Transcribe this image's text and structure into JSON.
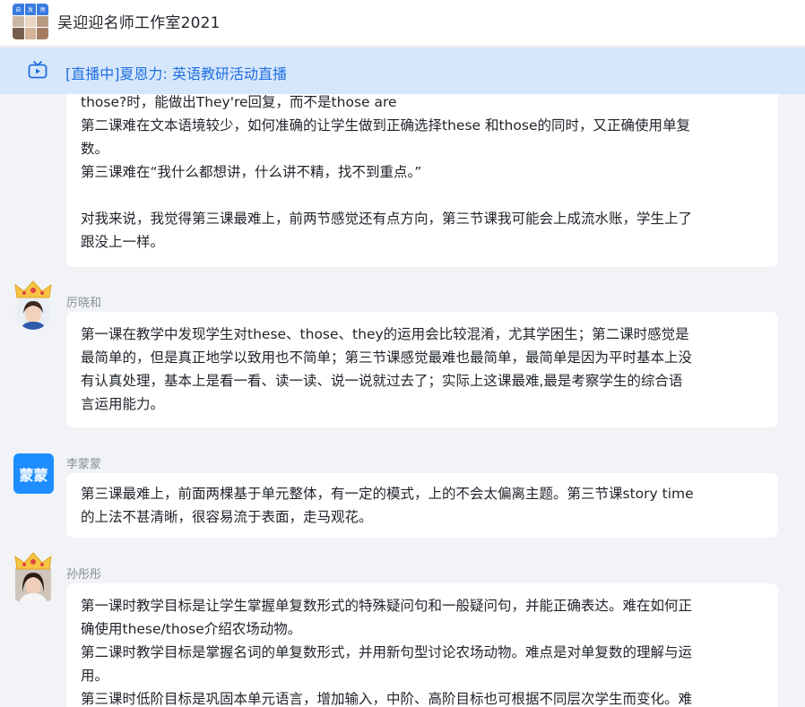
{
  "header": {
    "group_title": "吴迎迎名师工作室2021",
    "group_avatar_labels": [
      "自",
      "发",
      "师"
    ]
  },
  "live": {
    "text": "[直播中]夏恩力: 英语教研活动直播"
  },
  "messages": [
    {
      "sender": "",
      "lines": [
        "those?时，能做出They're回复，而不是those are",
        "第二课难在文本语境较少，如何准确的让学生做到正确选择these 和those的同时，又正确使用单复",
        "数。",
        "第三课难在“我什么都想讲，什么讲不精，找不到重点。”",
        "",
        "对我来说，我觉得第三课最难上，前两节感觉还有点方向，第三节课我可能会上成流水账，学生上了",
        "跟没上一样。"
      ]
    },
    {
      "sender": "厉晓和",
      "lines": [
        "第一课在教学中发现学生对these、those、they的运用会比较混淆，尤其学困生；第二课时感觉是",
        "最简单的，但是真正地学以致用也不简单；第三节课感觉最难也最简单，最简单是因为平时基本上没",
        "有认真处理，基本上是看一看、读一读、说一说就过去了；实际上这课最难,最是考察学生的综合语",
        "言运用能力。"
      ]
    },
    {
      "sender": "李蒙蒙",
      "avatar_text": "蒙蒙",
      "lines": [
        "第三课最难上，前面两棵基于单元整体，有一定的模式，上的不会太偏离主题。第三节课story time",
        "的上法不甚清晰，很容易流于表面，走马观花。"
      ]
    },
    {
      "sender": "孙彤彤",
      "lines": [
        "第一课时教学目标是让学生掌握单复数形式的特殊疑问句和一般疑问句，并能正确表达。难在如何正",
        "确使用these/those介绍农场动物。",
        "第二课时教学目标是掌握名词的单复数形式，并用新句型讨论农场动物。难点是对单复数的理解与运",
        "用。",
        "第三课时低阶目标是巩固本单元语言，增加输入，中阶、高阶目标也可根据不同层次学生而变化。难"
      ]
    }
  ],
  "colors": {
    "accent": "#1f6fe0",
    "live_bg": "#d7e7fb",
    "avatar_blue": "#1e8dff",
    "feed_bg": "#f1f3f6"
  },
  "icons": {
    "live": "tv-live-icon",
    "crown": "crown-icon"
  }
}
